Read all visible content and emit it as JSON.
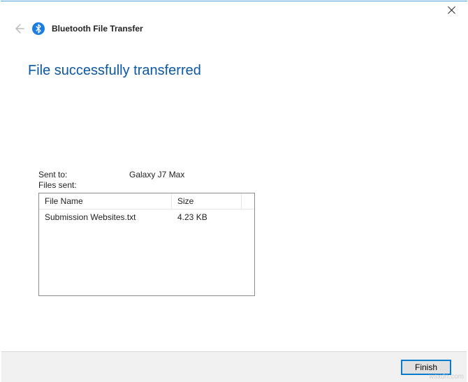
{
  "window": {
    "app_title": "Bluetooth File Transfer"
  },
  "heading": "File successfully transferred",
  "info": {
    "sent_to_label": "Sent to:",
    "sent_to_value": "Galaxy J7 Max",
    "files_sent_label": "Files sent:"
  },
  "table": {
    "headers": {
      "name": "File Name",
      "size": "Size"
    },
    "rows": [
      {
        "name": "Submission Websites.txt",
        "size": "4.23 KB"
      }
    ]
  },
  "buttons": {
    "finish": "Finish"
  },
  "watermark": "wsxdn.com"
}
